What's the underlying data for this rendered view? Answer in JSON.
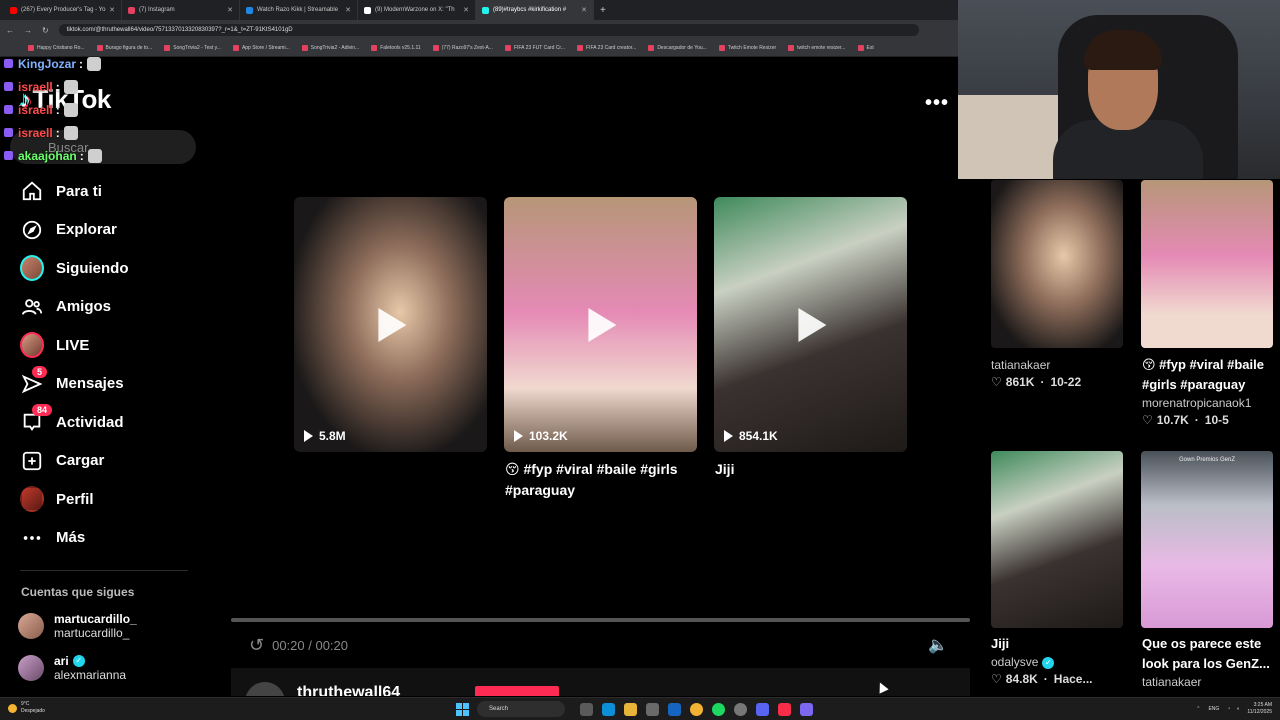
{
  "browser": {
    "tabs": [
      {
        "label": "(267) Every Producer's Tag - Yo",
        "color": "#ff0000"
      },
      {
        "label": "(7) Instagram",
        "color": "#e4405f"
      },
      {
        "label": "Watch Razo Kikk | Streamable",
        "color": "#1e88e5"
      },
      {
        "label": "(9) ModernWarzone on X: \"Th",
        "color": "#ffffff"
      },
      {
        "label": "(89)#traybcs #kirkification #",
        "color": "#25f4ee"
      }
    ],
    "new_tab": "+",
    "url": "tiktok.com/@thruthewall64/video/7571337013320830397?_r=1&_t=ZT-91KtS4101gD",
    "bookmarks": [
      "Happy Cristiano Ro...",
      "Burago figura de to...",
      "SongTrivia2 - Test y...",
      "App Store / Streami...",
      "SongTrivia2 - Adivin...",
      "Faletools v25.1.11",
      "(77) Razo97's Zest-A...",
      "FIFA 23 FUT Card Cr...",
      "FIFA 23 Card creator...",
      "Descargador de You...",
      "Twitch Emote Resizer",
      "twitch emote resizer...",
      "Est"
    ]
  },
  "chat": [
    {
      "user": "KingJozar",
      "sep": ":",
      "color": "#7fb2ff"
    },
    {
      "user": "israell",
      "sep": ":",
      "color": "#ff4b4b"
    },
    {
      "user": "israell",
      "sep": ":",
      "color": "#ff4b4b"
    },
    {
      "user": "israell",
      "sep": ":",
      "color": "#ff4b4b"
    },
    {
      "user": "akaajohan",
      "sep": ":",
      "color": "#6bff6b"
    }
  ],
  "logo": {
    "text": "TikTok"
  },
  "search": {
    "placeholder": "Buscar"
  },
  "nav": [
    {
      "label": "Para ti",
      "icon": "home-icon"
    },
    {
      "label": "Explorar",
      "icon": "compass-icon"
    },
    {
      "label": "Siguiendo",
      "icon": "following-avatar-icon"
    },
    {
      "label": "Amigos",
      "icon": "friends-icon"
    },
    {
      "label": "LIVE",
      "icon": "live-avatar-icon"
    },
    {
      "label": "Mensajes",
      "icon": "send-icon",
      "badge": "5"
    },
    {
      "label": "Actividad",
      "icon": "inbox-icon",
      "badge": "84"
    },
    {
      "label": "Cargar",
      "icon": "upload-icon"
    },
    {
      "label": "Perfil",
      "icon": "profile-avatar-icon"
    },
    {
      "label": "Más",
      "icon": "more-icon"
    }
  ],
  "following": {
    "title": "Cuentas que sigues",
    "accounts": [
      {
        "name": "martucardillo_",
        "handle": "martucardillo_",
        "verified": false
      },
      {
        "name": "ari",
        "handle": "alexmarianna",
        "verified": true
      }
    ]
  },
  "main": {
    "more": "•••",
    "videos": [
      {
        "views": "5.8M",
        "caption": ""
      },
      {
        "views": "103.2K",
        "caption": "😚 #fyp #viral #baile #girls #paraguay"
      },
      {
        "views": "854.1K",
        "caption": "Jiji"
      }
    ],
    "player": {
      "time": "00:20 / 00:20"
    },
    "author": "thruthewall64"
  },
  "right": [
    {
      "title": "",
      "user": "tatianakaer",
      "likes": "861K",
      "date": "10-22"
    },
    {
      "title": "😚 #fyp #viral #baile #girls #paraguay",
      "user": "morenatropicanaok1",
      "likes": "10.7K",
      "date": "10-5"
    },
    {
      "title": "Jiji",
      "user": "odalysve",
      "likes": "84.8K",
      "date": "Hace...",
      "verified": true
    },
    {
      "title": "Que os parece este look para los GenZ...",
      "user": "tatianakaer",
      "likes": "",
      "date": "",
      "overlay": "Gown Premios GenZ"
    }
  ],
  "taskbar": {
    "temp": "9°C",
    "weather": "Despejado",
    "search": "Search",
    "lang": "ENG",
    "time": "3:25 AM",
    "date": "11/12/2025"
  }
}
